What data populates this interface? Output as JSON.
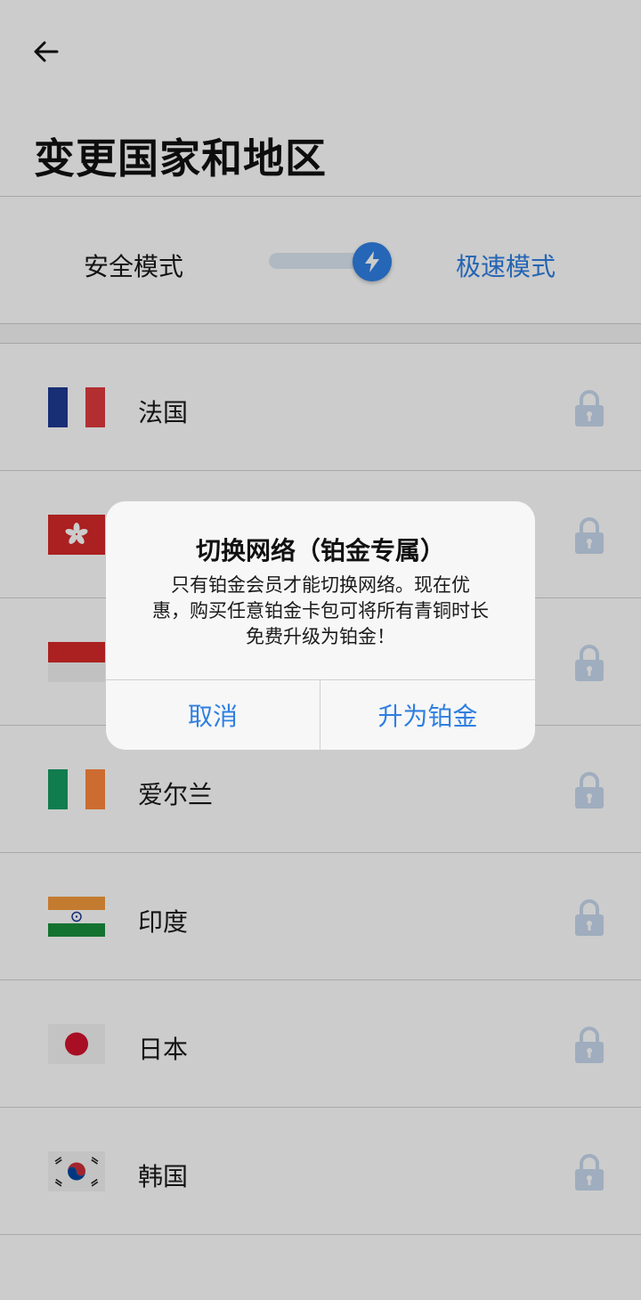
{
  "header": {
    "title": "变更国家和地区"
  },
  "mode": {
    "safe_label": "安全模式",
    "fast_label": "极速模式",
    "selected": "fast"
  },
  "countries": [
    {
      "name": "法国",
      "flag": "france-flag",
      "locked": true
    },
    {
      "name": "",
      "flag": "hong-kong-flag",
      "locked": true
    },
    {
      "name": "",
      "flag": "indonesia-flag",
      "locked": true
    },
    {
      "name": "爱尔兰",
      "flag": "ireland-flag",
      "locked": true
    },
    {
      "name": "印度",
      "flag": "india-flag",
      "locked": true
    },
    {
      "name": "日本",
      "flag": "japan-flag",
      "locked": true
    },
    {
      "name": "韩国",
      "flag": "korea-flag",
      "locked": true
    }
  ],
  "dialog": {
    "title": "切换网络（铂金专属）",
    "message_line1": "只有铂金会员才能切换网络。现在优",
    "message_line2": "惠，购买任意铂金卡包可将所有青铜时长",
    "message_line3": "免费升级为铂金！",
    "cancel_label": "取消",
    "confirm_label": "升为铂金"
  },
  "colors": {
    "accent": "#2f7fe0",
    "lock": "#c7d9ee",
    "overlay": "rgba(0,0,0,0.2)"
  }
}
